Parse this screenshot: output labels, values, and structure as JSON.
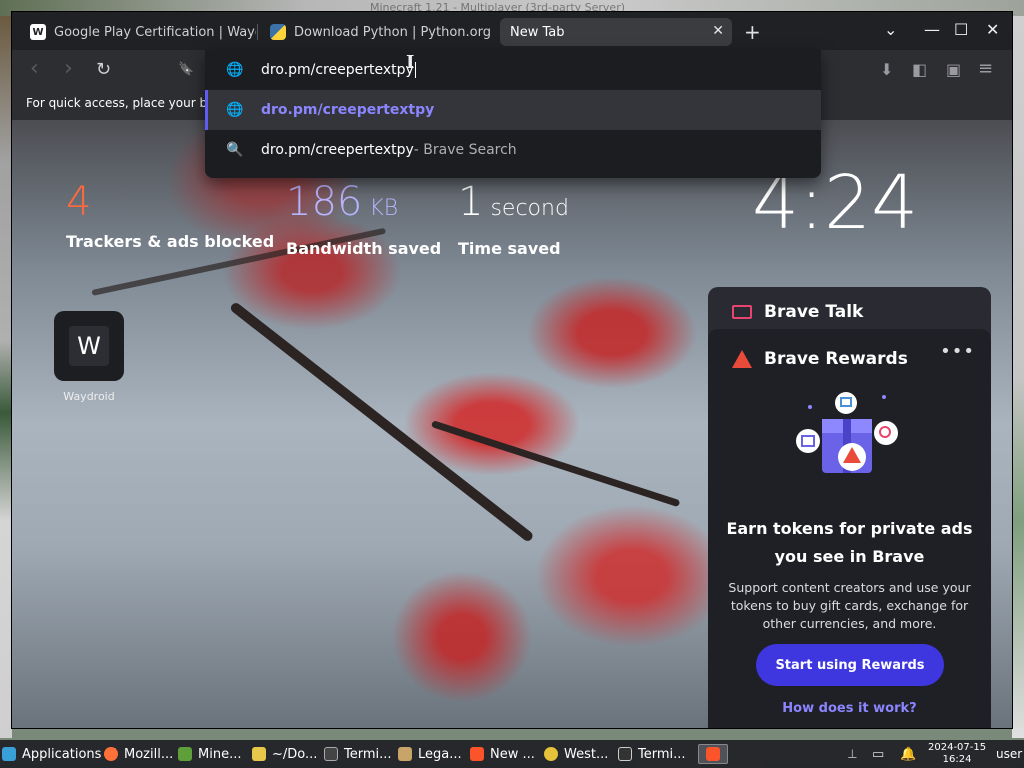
{
  "desktop": {
    "bg_title": "Minecraft 1.21 - Multiplayer (3rd-party Server)"
  },
  "tabs": [
    {
      "title": "Google Play Certification | Waydro",
      "favicon": "W"
    },
    {
      "title": "Download Python | Python.org"
    },
    {
      "title": "New Tab",
      "close": "✕"
    }
  ],
  "tabbar": {
    "new_tab": "+",
    "dropdown": "⌄",
    "minimize": "—",
    "maximize": "☐",
    "close": "✕"
  },
  "toolbar": {
    "back": "‹",
    "forward": "›",
    "reload": "↻",
    "bookmark": "🔖",
    "download": "⬇",
    "sidebar": "◧",
    "wallet": "▣",
    "menu": "≡"
  },
  "bookmarks_bar": {
    "text": "For quick access, place your bo"
  },
  "omnibox": {
    "input": "dro.pm/creepertextpy",
    "suggestions": [
      {
        "text": "dro.pm/creepertextpy",
        "icon": "globe-icon"
      },
      {
        "text": "dro.pm/creepertextpy",
        "suffix": " - Brave Search",
        "icon": "search-icon"
      }
    ]
  },
  "stats": {
    "trackers": {
      "value": "4",
      "label": "Trackers & ads blocked"
    },
    "bandwidth": {
      "value": "186",
      "unit": " KB",
      "label": "Bandwidth saved"
    },
    "time": {
      "value": "1",
      "unit": " second",
      "label": "Time saved"
    }
  },
  "clock": "4:24",
  "top_sites": [
    {
      "label": "Waydroid",
      "letter": "W"
    }
  ],
  "brave_talk": {
    "title": "Brave Talk"
  },
  "brave_rewards": {
    "title": "Brave Rewards",
    "more": "•••",
    "headline": "Earn tokens for private ads you see in Brave",
    "description": "Support content creators and use your tokens to buy gift cards, exchange for other currencies, and more.",
    "cta": "Start using Rewards",
    "link": "How does it work?"
  },
  "taskbar": {
    "items": [
      {
        "label": "Applications ☰"
      },
      {
        "label": "Mozill..."
      },
      {
        "label": "Mine..."
      },
      {
        "label": "~/Do..."
      },
      {
        "label": "Termi..."
      },
      {
        "label": "Lega..."
      },
      {
        "label": "New ..."
      },
      {
        "label": "West..."
      },
      {
        "label": "Termi..."
      }
    ],
    "date": "2024-07-15",
    "time": "16:24",
    "user": "user"
  },
  "colors": {
    "accent": "#3e37e0",
    "link": "#8b86ff",
    "tracker_orange": "#ff6a3d",
    "bandwidth_purple": "#b9b4ff"
  }
}
